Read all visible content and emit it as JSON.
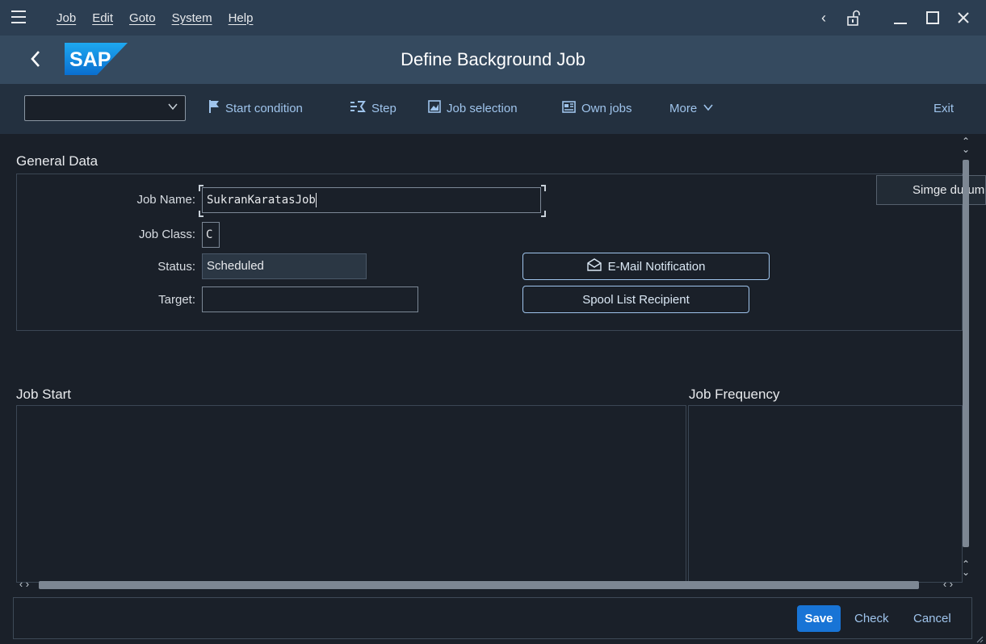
{
  "menubar": {
    "items": [
      "Job",
      "Edit",
      "Goto",
      "System",
      "Help"
    ]
  },
  "titlebar": {
    "title": "Define Background Job",
    "logo_text": "SAP"
  },
  "toolbar": {
    "dropdown_value": "",
    "start_condition": "Start condition",
    "step": "Step",
    "job_selection": "Job selection",
    "own_jobs": "Own jobs",
    "more": "More",
    "exit": "Exit"
  },
  "general": {
    "title": "General Data",
    "job_name_label": "Job Name:",
    "job_name_value": "SukranKaratasJob",
    "job_class_label": "Job Class:",
    "job_class_value": "C",
    "status_label": "Status:",
    "status_value": "Scheduled",
    "target_label": "Target:",
    "target_value": "",
    "email_button": "E-Mail Notification",
    "spool_button": "Spool List Recipient"
  },
  "tooltip": "Simge durumuna küçült",
  "job_start": {
    "title": "Job Start"
  },
  "job_frequency": {
    "title": "Job Frequency"
  },
  "footer": {
    "save": "Save",
    "check": "Check",
    "cancel": "Cancel"
  },
  "colors": {
    "accent": "#1874d6",
    "link": "#9fc4ec",
    "background": "#1a2029",
    "shell": "#354a5f"
  }
}
